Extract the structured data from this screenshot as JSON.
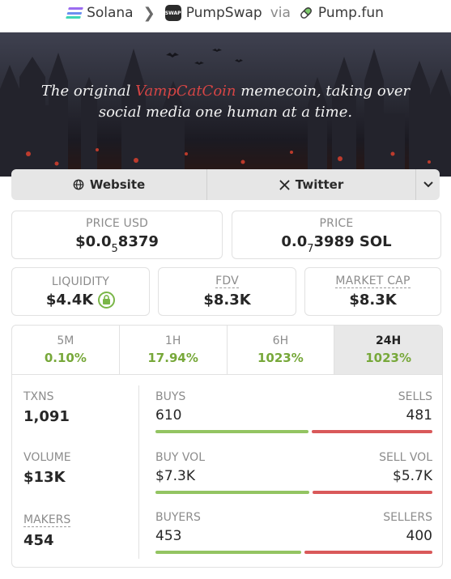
{
  "breadcrumb": {
    "chain": "Solana",
    "dex": "PumpSwap",
    "dex_icon_text": "SWAP",
    "via": "via",
    "launchpad": "Pump.fun"
  },
  "banner": {
    "tagline_pre": "The original ",
    "tagline_highlight": "VampCatCoin",
    "tagline_post": " memecoin, taking over",
    "tagline_line2": "social media one human at a time.",
    "highlight_color": "#d64545"
  },
  "links": {
    "website": "Website",
    "twitter": "Twitter",
    "icons": [
      "globe-icon",
      "x-logo-icon",
      "chevron-down-icon"
    ]
  },
  "price": {
    "usd_label": "PRICE USD",
    "usd_prefix": "$0.0",
    "usd_zeros": "5",
    "usd_digits": "8379",
    "native_label": "PRICE",
    "native_prefix": "0.0",
    "native_zeros": "7",
    "native_digits": "3989 SOL"
  },
  "metrics": {
    "liquidity_label": "LIQUIDITY",
    "liquidity_value": "$4.4K",
    "fdv_label": "FDV",
    "fdv_value": "$8.3K",
    "mcap_label": "MARKET CAP",
    "mcap_value": "$8.3K"
  },
  "timeframes": [
    {
      "label": "5M",
      "change": "0.10%"
    },
    {
      "label": "1H",
      "change": "17.94%"
    },
    {
      "label": "6H",
      "change": "1023%"
    },
    {
      "label": "24H",
      "change": "1023%",
      "active": true
    }
  ],
  "stats": {
    "txns_label": "TXNS",
    "txns_value": "1,091",
    "volume_label": "VOLUME",
    "volume_value": "$13K",
    "makers_label": "MAKERS",
    "makers_value": "454"
  },
  "rows": [
    {
      "left_label": "BUYS",
      "right_label": "SELLS",
      "left_value": "610",
      "right_value": "481",
      "buy_fraction": 0.559
    },
    {
      "left_label": "BUY VOL",
      "right_label": "SELL VOL",
      "left_value": "$7.3K",
      "right_value": "$5.7K",
      "buy_fraction": 0.561
    },
    {
      "left_label": "BUYERS",
      "right_label": "SELLERS",
      "left_value": "453",
      "right_value": "400",
      "buy_fraction": 0.531
    }
  ],
  "colors": {
    "positive": "#77a83a",
    "buy_bar": "#93c462",
    "sell_bar": "#d9595a"
  }
}
